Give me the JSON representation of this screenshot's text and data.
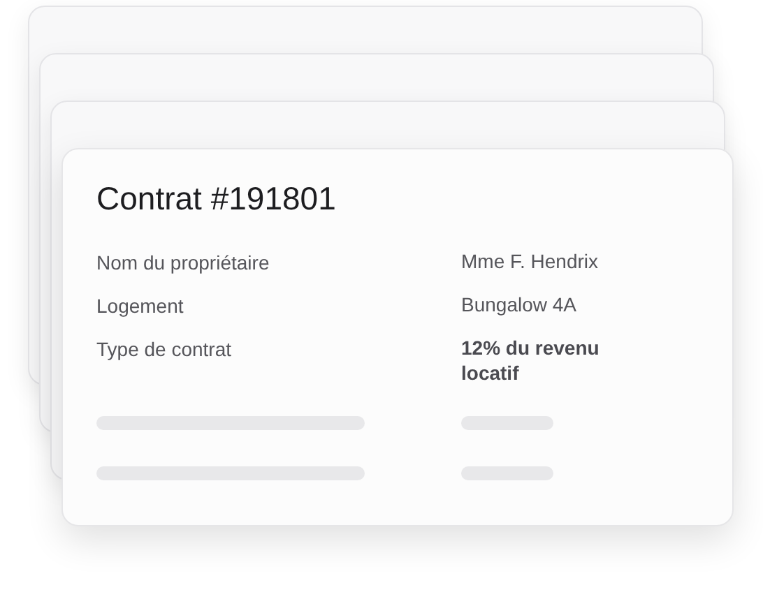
{
  "card": {
    "title": "Contrat #191801",
    "fields": [
      {
        "label": "Nom du propriétaire",
        "value": "Mme F. Hendrix",
        "emphasized": false
      },
      {
        "label": "Logement",
        "value": "Bungalow 4A",
        "emphasized": false
      },
      {
        "label": "Type de contrat",
        "value": "12% du revenu locatif",
        "emphasized": true
      }
    ]
  }
}
